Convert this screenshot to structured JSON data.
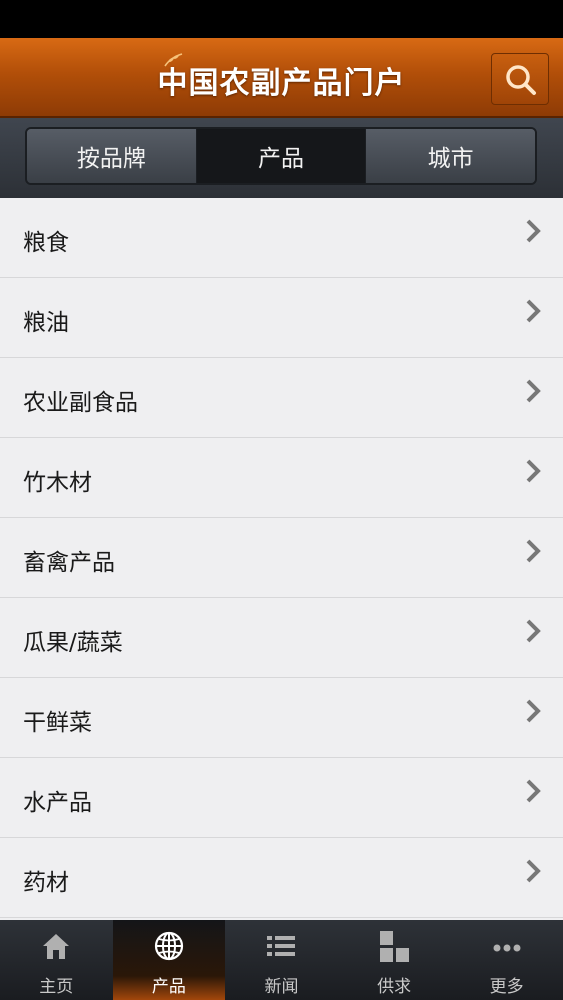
{
  "header": {
    "title": "中国农副产品门户"
  },
  "segments": [
    {
      "label": "按品牌",
      "active": false
    },
    {
      "label": "产品",
      "active": true
    },
    {
      "label": "城市",
      "active": false
    }
  ],
  "categories": [
    {
      "label": "粮食"
    },
    {
      "label": "粮油"
    },
    {
      "label": "农业副食品"
    },
    {
      "label": "竹木材"
    },
    {
      "label": "畜禽产品"
    },
    {
      "label": "瓜果/蔬菜"
    },
    {
      "label": "干鲜菜"
    },
    {
      "label": "水产品"
    },
    {
      "label": "药材"
    }
  ],
  "tabbar": [
    {
      "label": "主页",
      "icon": "home-icon"
    },
    {
      "label": "产品",
      "icon": "globe-icon",
      "active": true
    },
    {
      "label": "新闻",
      "icon": "list-icon"
    },
    {
      "label": "供求",
      "icon": "blocks-icon"
    },
    {
      "label": "更多",
      "icon": "more-icon"
    }
  ],
  "colors": {
    "header": "#c45a10",
    "active_tab_glow": "#a2470b",
    "list_bg": "#efeff1"
  }
}
